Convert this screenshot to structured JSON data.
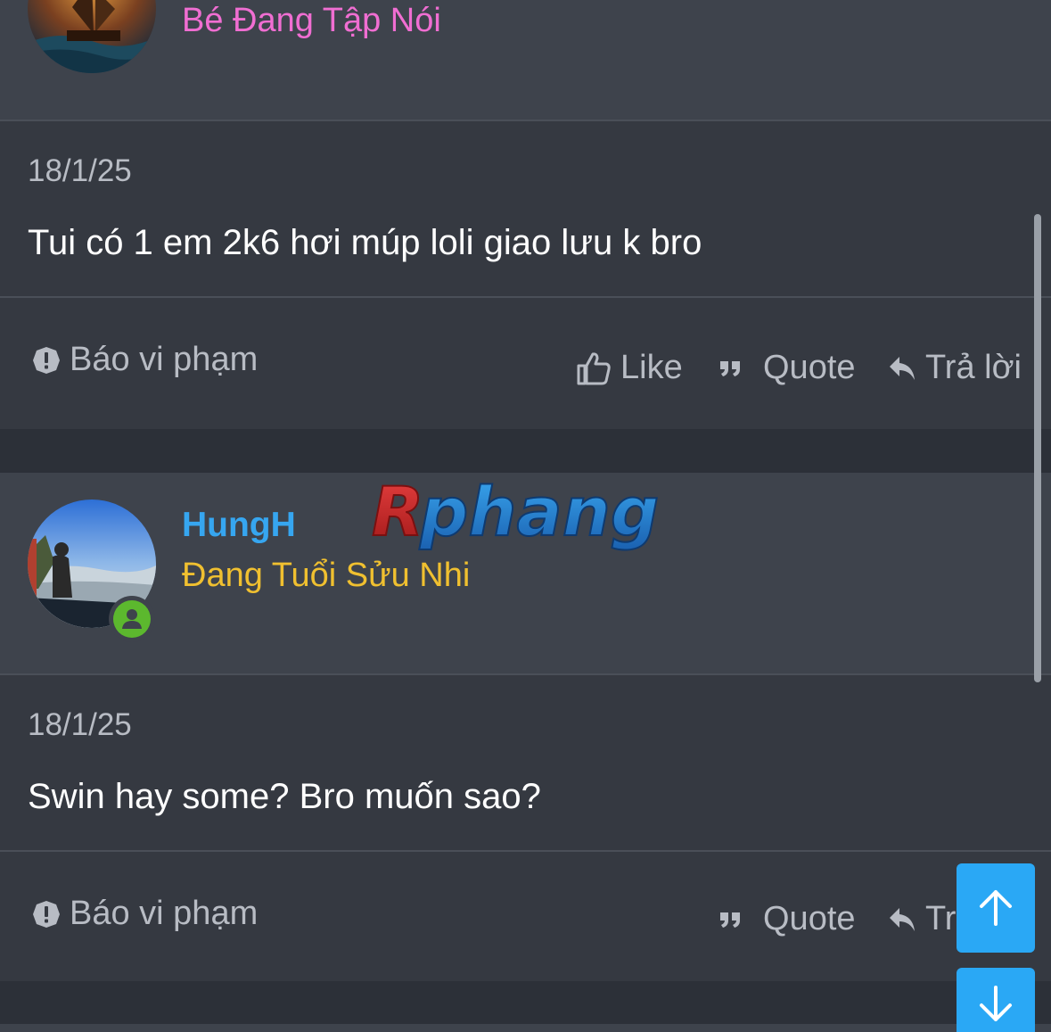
{
  "posts": [
    {
      "user_title": "Bé Đang Tập Nói",
      "date": "18/1/25",
      "body": "Tui có 1 em 2k6 hơi múp loli giao lưu k bro",
      "report_label": "Báo vi phạm",
      "like_label": "Like",
      "quote_label": "Quote",
      "reply_label": "Trả lời"
    },
    {
      "username": "HungH",
      "user_title": "Đang Tuổi Sửu Nhi",
      "date": "18/1/25",
      "body": "Swin hay some? Bro muốn sao?",
      "report_label": "Báo vi phạm",
      "quote_label": "Quote",
      "reply_label": "Tr"
    }
  ],
  "watermark": "Rphang",
  "colors": {
    "accent": "#36a6f0",
    "title_pink": "#f06ed2",
    "title_gold": "#f0c030",
    "online": "#5cb82e",
    "fab": "#2aa8f5"
  },
  "icons": {
    "report": "exclamation-circle-icon",
    "like": "thumbs-up-icon",
    "quote": "quote-icon",
    "reply": "reply-arrow-icon",
    "online": "user-online-icon",
    "scroll_up": "arrow-up-icon",
    "scroll_down": "arrow-down-icon"
  }
}
